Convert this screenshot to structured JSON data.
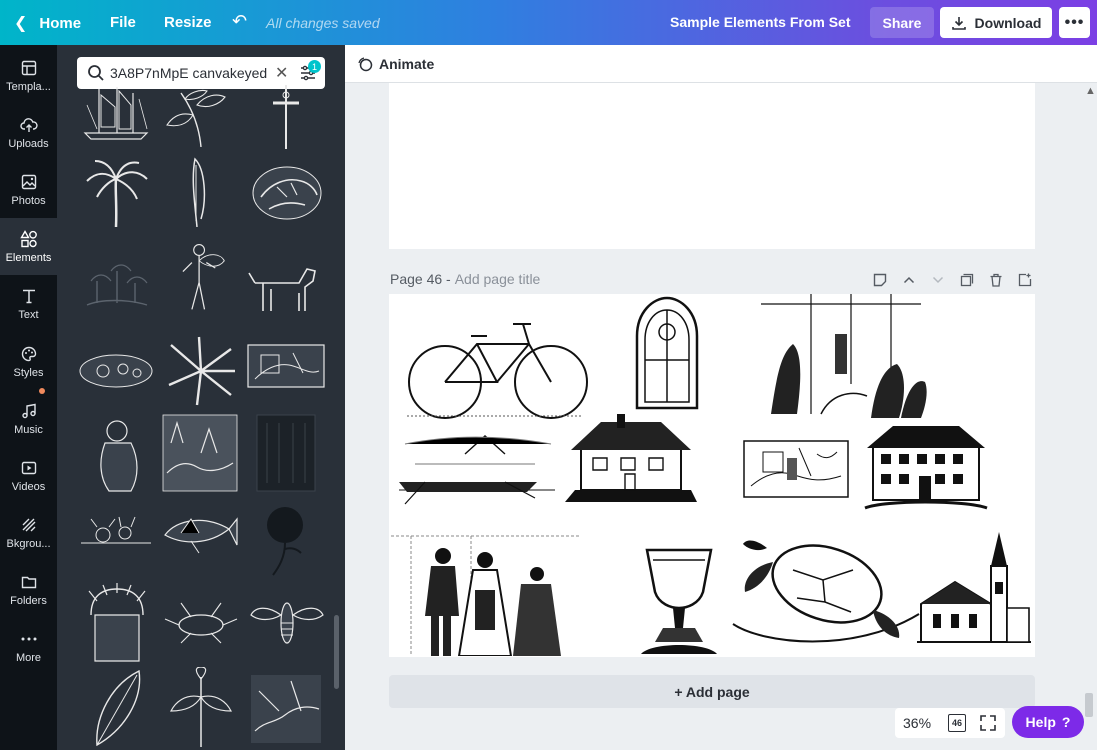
{
  "topbar": {
    "home": "Home",
    "file": "File",
    "resize": "Resize",
    "saved_status": "All changes saved",
    "design_title": "Sample Elements From Set",
    "share": "Share",
    "download": "Download",
    "more": "•••",
    "gradient_colors": [
      "#00b5c9",
      "#2f7fe0",
      "#6b4fdf",
      "#7b3fe4"
    ]
  },
  "rail": {
    "items": [
      {
        "label": "Templa...",
        "icon": "templates-icon"
      },
      {
        "label": "Uploads",
        "icon": "uploads-icon"
      },
      {
        "label": "Photos",
        "icon": "photos-icon"
      },
      {
        "label": "Elements",
        "icon": "elements-icon",
        "active": true
      },
      {
        "label": "Text",
        "icon": "text-icon"
      },
      {
        "label": "Styles",
        "icon": "styles-icon"
      },
      {
        "label": "Music",
        "icon": "music-icon"
      },
      {
        "label": "Videos",
        "icon": "videos-icon"
      },
      {
        "label": "Bkgrou...",
        "icon": "background-icon"
      },
      {
        "label": "Folders",
        "icon": "folders-icon"
      },
      {
        "label": "More",
        "icon": "more-icon"
      }
    ]
  },
  "search": {
    "value": "3A8P7nMpE canvakeyed",
    "filter_count": "1"
  },
  "canvas": {
    "animate": "Animate",
    "page_number": "Page 46 -",
    "page_title_placeholder": "Add page title",
    "add_page": "+ Add page"
  },
  "bottom": {
    "zoom": "36%",
    "page_count": "46",
    "help": "Help",
    "help_icon": "?",
    "help_color": "#7d2ae8"
  }
}
